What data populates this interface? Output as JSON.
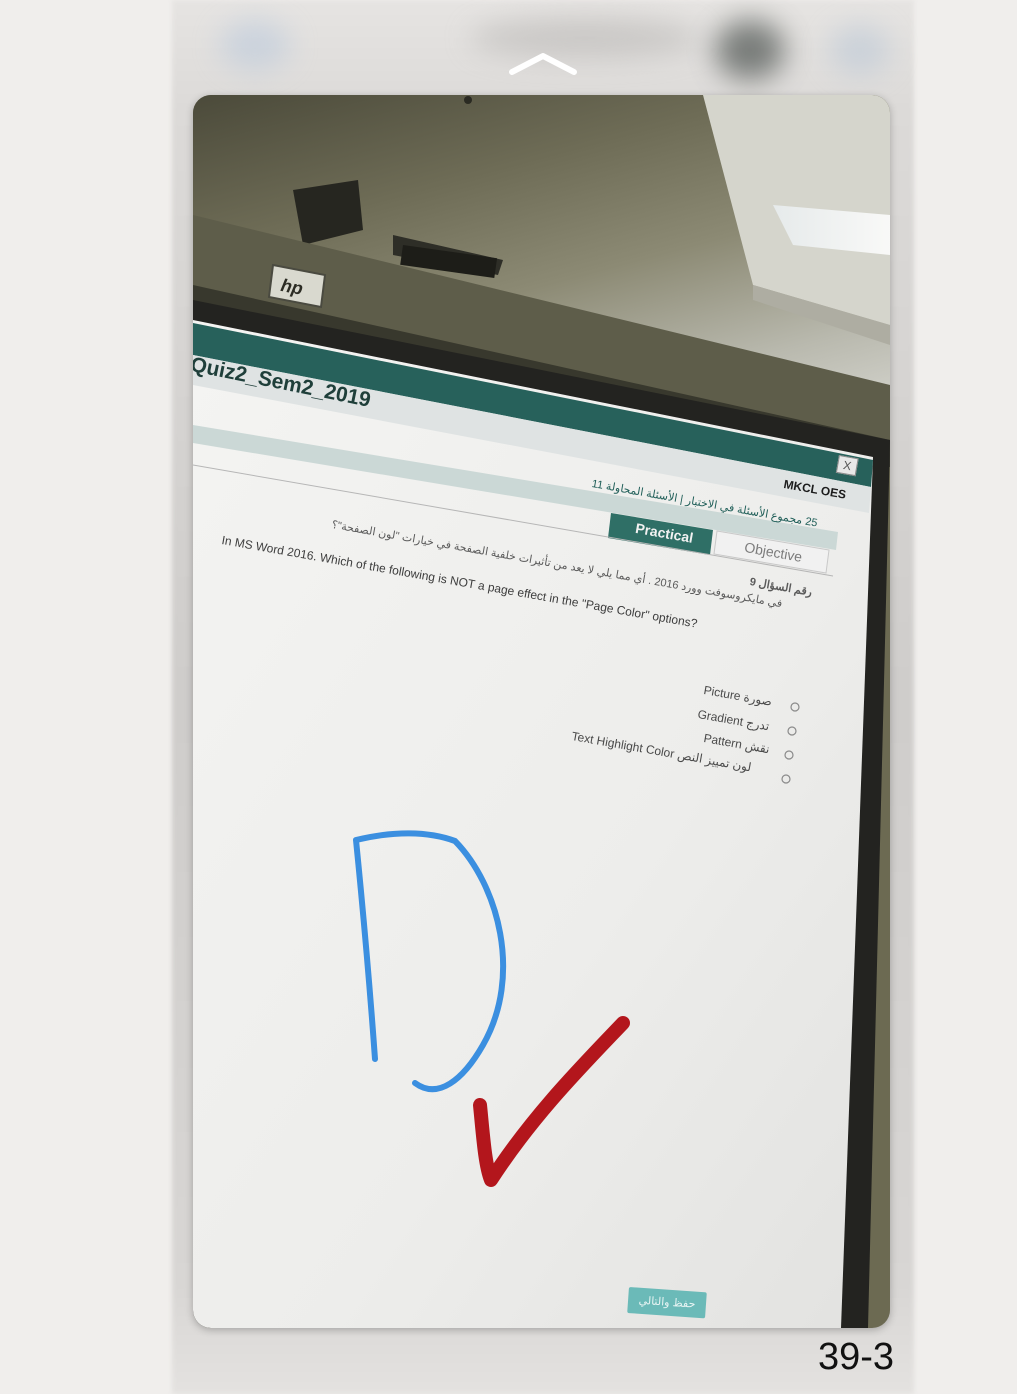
{
  "photo": {
    "brand_logo": "hp",
    "window_title": "Quiz2_Sem2_2019",
    "app_brand": "MKCL OES",
    "close_glyph": "X",
    "status_line": "25 مجموع الأسئلة في الاختبار | الأسئلة المحاولة 11",
    "tabs": [
      {
        "label": "Practical",
        "active": true
      },
      {
        "label": "Objective",
        "active": false
      }
    ],
    "question_number": "رقم السؤال 9",
    "question_en": "In MS Word 2016. Which of the following is NOT a page effect in the \"Page Color\" options?",
    "question_ar": "في مايكروسوفت وورد 2016 . أي مما يلي لا يعد من تأثيرات خلفية الصفحة في خيارات \"لون الصفحة\"؟",
    "options": [
      "صورة Picture",
      "تدرج Gradient",
      "نقش Pattern",
      "لون تمييز النص Text Highlight Color"
    ],
    "submit_label": "حفظ والتالي",
    "handwritten_answer": "D",
    "answer_mark": "check-mark"
  },
  "page_label": "39-3",
  "colors": {
    "title_bar": "#27615b",
    "active_tab": "#2f6f66",
    "answer_ink": "#3b8fe0",
    "check_ink": "#b3161c"
  }
}
